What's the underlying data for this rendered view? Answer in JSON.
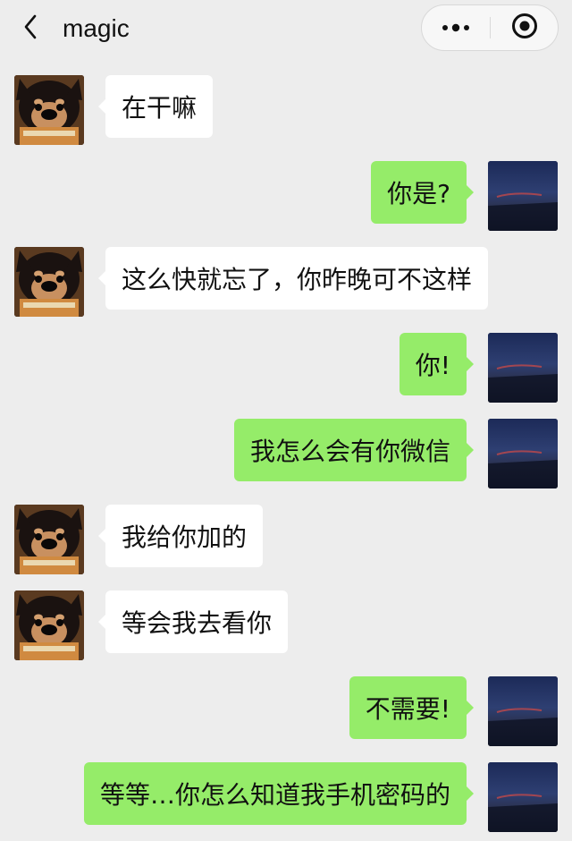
{
  "header": {
    "back_icon": "chevron-left-icon",
    "title": "magic",
    "more_icon": "more-dots-icon",
    "close_icon": "target-close-icon"
  },
  "colors": {
    "background": "#ededed",
    "incoming_bubble": "#ffffff",
    "outgoing_bubble": "#95ec69"
  },
  "messages": [
    {
      "side": "left",
      "text": "在干嘛"
    },
    {
      "side": "right",
      "text": "你是?"
    },
    {
      "side": "left",
      "text": "这么快就忘了，你昨晚可不这样"
    },
    {
      "side": "right",
      "text": "你!"
    },
    {
      "side": "right",
      "text": "我怎么会有你微信"
    },
    {
      "side": "left",
      "text": "我给你加的"
    },
    {
      "side": "left",
      "text": "等会我去看你"
    },
    {
      "side": "right",
      "text": "不需要!"
    },
    {
      "side": "right",
      "text": "等等…你怎么知道我手机密码的"
    }
  ]
}
